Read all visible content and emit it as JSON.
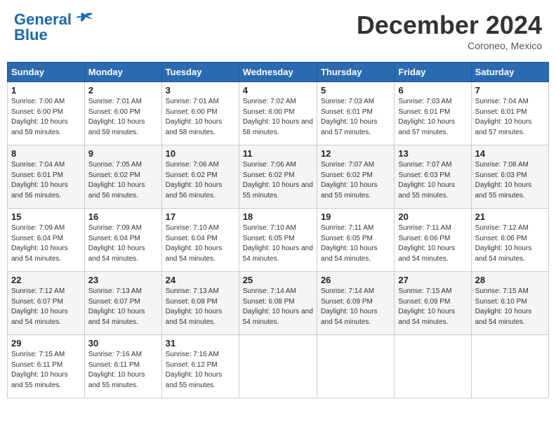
{
  "header": {
    "logo_line1": "General",
    "logo_line2": "Blue",
    "month_title": "December 2024",
    "location": "Coroneo, Mexico"
  },
  "weekdays": [
    "Sunday",
    "Monday",
    "Tuesday",
    "Wednesday",
    "Thursday",
    "Friday",
    "Saturday"
  ],
  "weeks": [
    [
      {
        "day": "1",
        "sunrise": "7:00 AM",
        "sunset": "6:00 PM",
        "daylight": "10 hours and 59 minutes."
      },
      {
        "day": "2",
        "sunrise": "7:01 AM",
        "sunset": "6:00 PM",
        "daylight": "10 hours and 59 minutes."
      },
      {
        "day": "3",
        "sunrise": "7:01 AM",
        "sunset": "6:00 PM",
        "daylight": "10 hours and 58 minutes."
      },
      {
        "day": "4",
        "sunrise": "7:02 AM",
        "sunset": "6:00 PM",
        "daylight": "10 hours and 58 minutes."
      },
      {
        "day": "5",
        "sunrise": "7:03 AM",
        "sunset": "6:01 PM",
        "daylight": "10 hours and 57 minutes."
      },
      {
        "day": "6",
        "sunrise": "7:03 AM",
        "sunset": "6:01 PM",
        "daylight": "10 hours and 57 minutes."
      },
      {
        "day": "7",
        "sunrise": "7:04 AM",
        "sunset": "6:01 PM",
        "daylight": "10 hours and 57 minutes."
      }
    ],
    [
      {
        "day": "8",
        "sunrise": "7:04 AM",
        "sunset": "6:01 PM",
        "daylight": "10 hours and 56 minutes."
      },
      {
        "day": "9",
        "sunrise": "7:05 AM",
        "sunset": "6:02 PM",
        "daylight": "10 hours and 56 minutes."
      },
      {
        "day": "10",
        "sunrise": "7:06 AM",
        "sunset": "6:02 PM",
        "daylight": "10 hours and 56 minutes."
      },
      {
        "day": "11",
        "sunrise": "7:06 AM",
        "sunset": "6:02 PM",
        "daylight": "10 hours and 55 minutes."
      },
      {
        "day": "12",
        "sunrise": "7:07 AM",
        "sunset": "6:02 PM",
        "daylight": "10 hours and 55 minutes."
      },
      {
        "day": "13",
        "sunrise": "7:07 AM",
        "sunset": "6:03 PM",
        "daylight": "10 hours and 55 minutes."
      },
      {
        "day": "14",
        "sunrise": "7:08 AM",
        "sunset": "6:03 PM",
        "daylight": "10 hours and 55 minutes."
      }
    ],
    [
      {
        "day": "15",
        "sunrise": "7:09 AM",
        "sunset": "6:04 PM",
        "daylight": "10 hours and 54 minutes."
      },
      {
        "day": "16",
        "sunrise": "7:09 AM",
        "sunset": "6:04 PM",
        "daylight": "10 hours and 54 minutes."
      },
      {
        "day": "17",
        "sunrise": "7:10 AM",
        "sunset": "6:04 PM",
        "daylight": "10 hours and 54 minutes."
      },
      {
        "day": "18",
        "sunrise": "7:10 AM",
        "sunset": "6:05 PM",
        "daylight": "10 hours and 54 minutes."
      },
      {
        "day": "19",
        "sunrise": "7:11 AM",
        "sunset": "6:05 PM",
        "daylight": "10 hours and 54 minutes."
      },
      {
        "day": "20",
        "sunrise": "7:11 AM",
        "sunset": "6:06 PM",
        "daylight": "10 hours and 54 minutes."
      },
      {
        "day": "21",
        "sunrise": "7:12 AM",
        "sunset": "6:06 PM",
        "daylight": "10 hours and 54 minutes."
      }
    ],
    [
      {
        "day": "22",
        "sunrise": "7:12 AM",
        "sunset": "6:07 PM",
        "daylight": "10 hours and 54 minutes."
      },
      {
        "day": "23",
        "sunrise": "7:13 AM",
        "sunset": "6:07 PM",
        "daylight": "10 hours and 54 minutes."
      },
      {
        "day": "24",
        "sunrise": "7:13 AM",
        "sunset": "6:08 PM",
        "daylight": "10 hours and 54 minutes."
      },
      {
        "day": "25",
        "sunrise": "7:14 AM",
        "sunset": "6:08 PM",
        "daylight": "10 hours and 54 minutes."
      },
      {
        "day": "26",
        "sunrise": "7:14 AM",
        "sunset": "6:09 PM",
        "daylight": "10 hours and 54 minutes."
      },
      {
        "day": "27",
        "sunrise": "7:15 AM",
        "sunset": "6:09 PM",
        "daylight": "10 hours and 54 minutes."
      },
      {
        "day": "28",
        "sunrise": "7:15 AM",
        "sunset": "6:10 PM",
        "daylight": "10 hours and 54 minutes."
      }
    ],
    [
      {
        "day": "29",
        "sunrise": "7:15 AM",
        "sunset": "6:11 PM",
        "daylight": "10 hours and 55 minutes."
      },
      {
        "day": "30",
        "sunrise": "7:16 AM",
        "sunset": "6:11 PM",
        "daylight": "10 hours and 55 minutes."
      },
      {
        "day": "31",
        "sunrise": "7:16 AM",
        "sunset": "6:12 PM",
        "daylight": "10 hours and 55 minutes."
      },
      null,
      null,
      null,
      null
    ]
  ]
}
